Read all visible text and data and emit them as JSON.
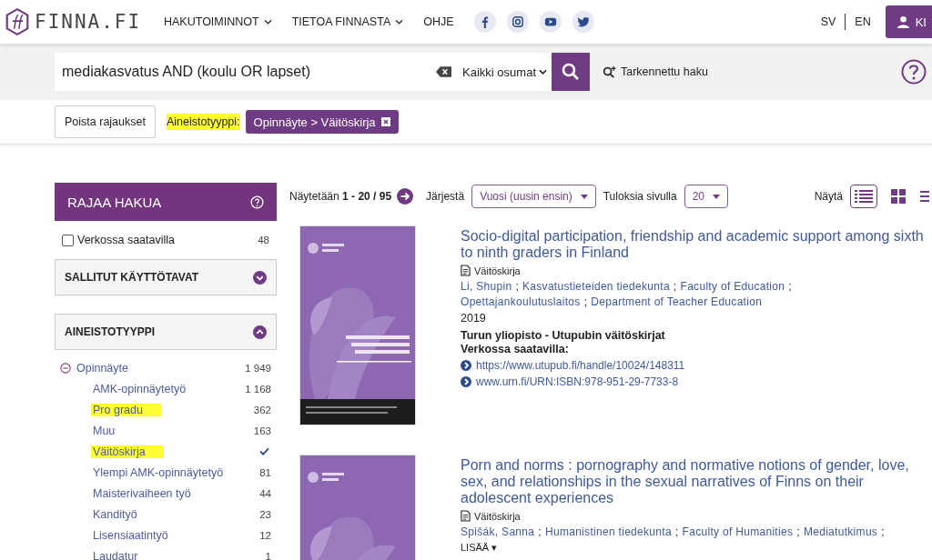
{
  "header": {
    "logo": "FINNA.FI",
    "nav": [
      {
        "label": "HAKUTOIMINNOT",
        "dropdown": true
      },
      {
        "label": "TIETOA FINNASTA",
        "dropdown": true
      },
      {
        "label": "OHJE",
        "dropdown": false
      }
    ],
    "social": [
      {
        "kind": "facebook"
      },
      {
        "kind": "instagram"
      },
      {
        "kind": "youtube"
      },
      {
        "kind": "twitter"
      }
    ],
    "languages": [
      "SV",
      "EN"
    ],
    "account": "KI"
  },
  "search": {
    "value": "mediakasvatus AND (koulu OR lapset)",
    "scope": "Kaikki osumat",
    "advanced": "Tarkennettu haku"
  },
  "filters": {
    "clear": "Poista rajaukset",
    "label": "Aineistotyyppi:",
    "label_highlighted": true,
    "chip": "Opinnäyte > Väitöskirja"
  },
  "sidebar": {
    "title": "RAJAA HAKUA",
    "online": {
      "label": "Verkossa saatavilla",
      "count": "48",
      "checked": false
    },
    "sections": [
      {
        "title": "SALLITUT KÄYTTÖTAVAT",
        "expanded": false
      },
      {
        "title": "AINEISTOTYYPPI",
        "expanded": true
      }
    ],
    "facet": {
      "label": "Opinnäyte",
      "count": "1 949",
      "expanded": true,
      "children": [
        {
          "label": "AMK-opinnäytetyö",
          "count": "1 168",
          "selected": false,
          "highlighted": false
        },
        {
          "label": "Pro gradu",
          "count": "362",
          "selected": false,
          "highlighted": true
        },
        {
          "label": "Muu",
          "count": "163",
          "selected": false,
          "highlighted": false
        },
        {
          "label": "Väitöskirja",
          "selected": true,
          "highlighted": true
        },
        {
          "label": "Ylempi AMK-opinnäytetyö",
          "count": "81",
          "selected": false,
          "highlighted": false
        },
        {
          "label": "Maisterivaiheen työ",
          "count": "44",
          "selected": false,
          "highlighted": false
        },
        {
          "label": "Kandityö",
          "count": "23",
          "selected": false,
          "highlighted": false
        },
        {
          "label": "Lisensiaatintyö",
          "count": "12",
          "selected": false,
          "highlighted": false
        },
        {
          "label": "Laudatur",
          "count": "1",
          "selected": false,
          "highlighted": false
        }
      ]
    }
  },
  "toolbar": {
    "showing": "Näytetään **1 - 20 / 95**",
    "sort_label": "Järjestä",
    "sort": "Vuosi (uusin ensin)",
    "per_page_label": "Tuloksia sivulla",
    "per_page": "20",
    "view_label": "Näytä",
    "views": [
      {
        "kind": "list",
        "selected": true
      },
      {
        "kind": "grid",
        "selected": false
      },
      {
        "kind": "compact",
        "selected": false
      }
    ]
  },
  "results": [
    {
      "title": "Socio-digital participation, friendship and academic support among sixth to ninth graders in Finland",
      "format": "Väitöskirja",
      "authors": [
        {
          "name": "Li, Shupin",
          "sep": ";"
        },
        {
          "name": "Kasvatustieteiden tiedekunta",
          "sep": ";"
        },
        {
          "name": "Faculty of Education",
          "sep": ";"
        },
        {
          "name": "Opettajankoulutuslaitos",
          "sep": ";"
        },
        {
          "name": "Department of Teacher Education"
        }
      ],
      "year": "2019",
      "source": "Turun yliopisto - Utupubin väitöskirjat",
      "online_label": "Verkossa saatavilla:",
      "links": [
        "https://www.utupub.fi/handle/10024/148311",
        "www.urn.fi/URN:ISBN:978-951-29-7733-8"
      ]
    },
    {
      "title": "Porn and norms : pornography and normative notions of gender, love, sex, and relationships in the sexual narratives of Finns on their adolescent experiences",
      "format": "Väitöskirja",
      "authors": [
        {
          "name": "Spišák, Sanna",
          "sep": ";"
        },
        {
          "name": "Humanistinen tiedekunta",
          "sep": ";"
        },
        {
          "name": "Faculty of Humanities",
          "sep": ";"
        },
        {
          "name": "Mediatutkimus",
          "sep": ";"
        }
      ],
      "more": "LISÄÄ ▾"
    }
  ]
}
